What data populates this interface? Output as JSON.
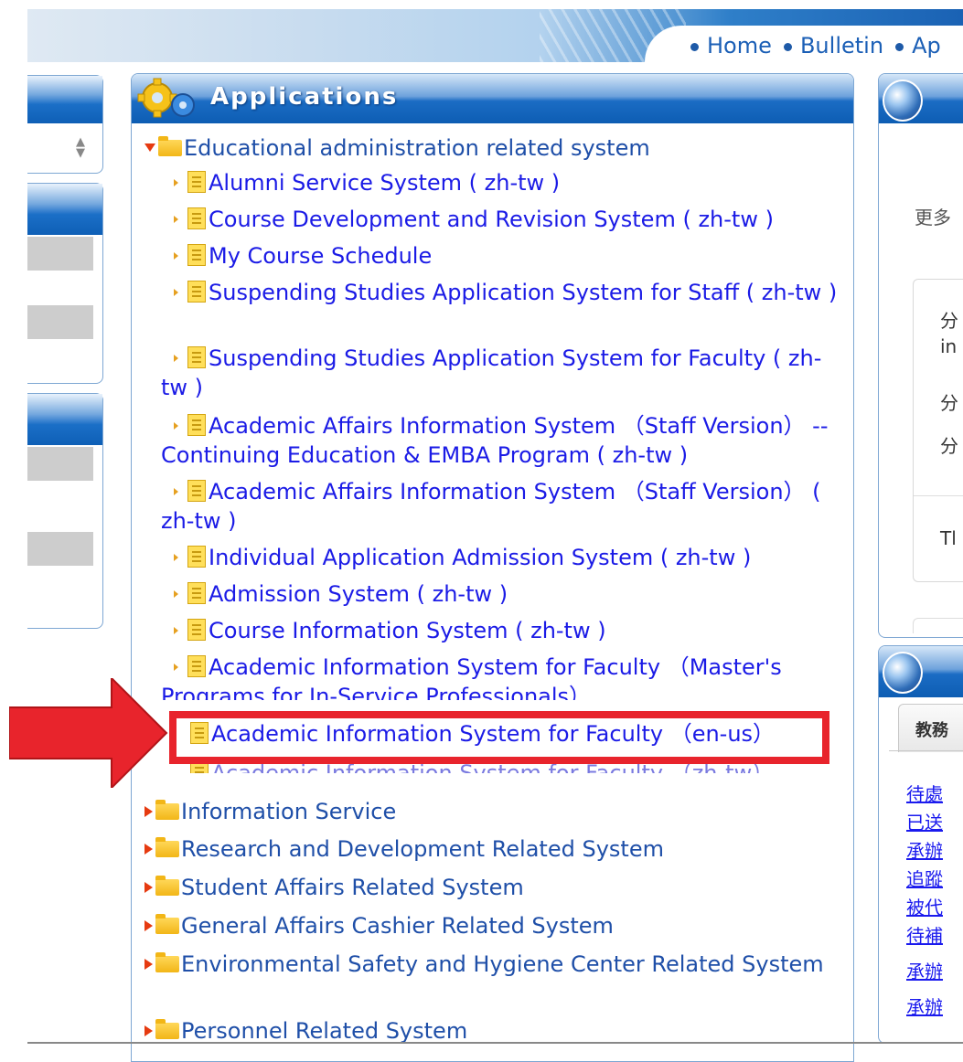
{
  "header": {
    "nav": [
      "Home",
      "Bulletin",
      "Ap"
    ]
  },
  "apps": {
    "title": "Applications",
    "category_open": "Educational administration related system",
    "items": [
      "Alumni Service System ( zh-tw )",
      "Course Development and Revision System ( zh-tw )",
      "My Course Schedule",
      "Suspending Studies Application System for Staff ( zh-tw )",
      "Suspending Studies Application System for Faculty ( zh-tw )",
      "Academic Affairs Information System （Staff Version） -- Continuing Education & EMBA Program ( zh-tw )",
      "Academic Affairs Information System （Staff Version） ( zh-tw )",
      "Individual Application Admission System ( zh-tw )",
      "Admission System ( zh-tw )",
      "Course Information System ( zh-tw )",
      "Academic Information System for Faculty （Master's Programs for In-Service Professionals）",
      "Academic Information System for Faculty （en-us）",
      "Academic Information System for Faculty （zh-tw）"
    ],
    "categories": [
      "Information Service",
      "Research and Development Related System",
      "Student Affairs Related System",
      "General Affairs Cashier Related System",
      "Environmental Safety and Hygiene Center Related System",
      "Personnel Related System"
    ]
  },
  "right": {
    "more_label": "更多",
    "box_lines": [
      "分",
      "in",
      "分",
      "分",
      "Tl"
    ],
    "tab_label": "教務",
    "links": [
      "待處",
      "已送",
      "承辦",
      "追蹤",
      "被代",
      "待補",
      "承辦",
      "承辦"
    ]
  },
  "colors": {
    "highlight": "#e8242c",
    "link": "#1b1be6",
    "header_blue": "#1b6cc4"
  }
}
